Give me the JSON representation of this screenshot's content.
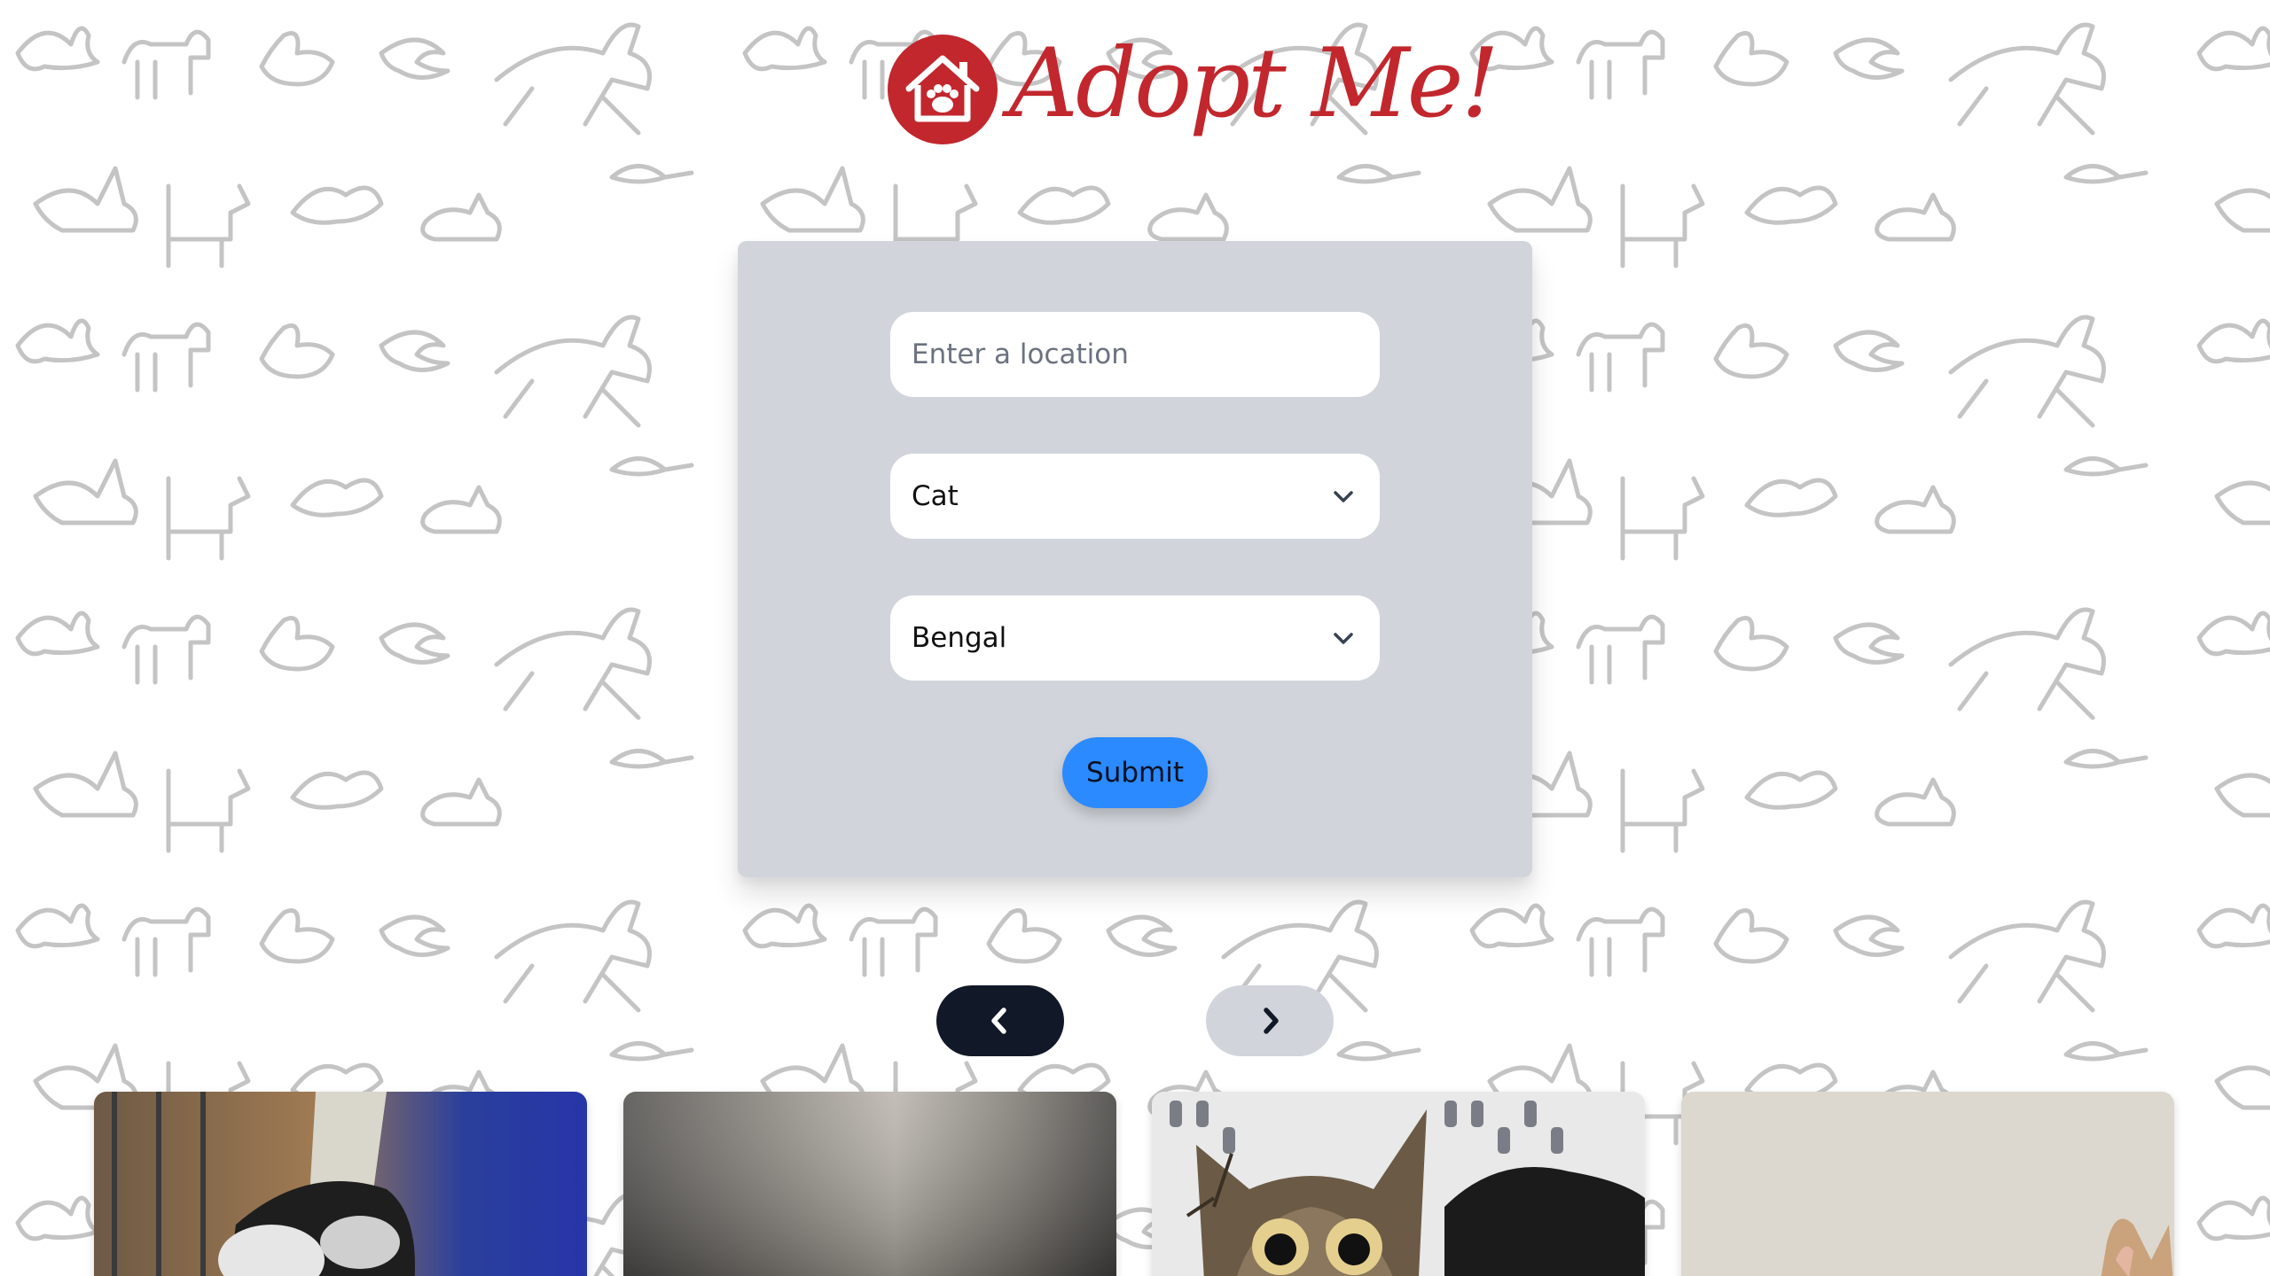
{
  "brand": {
    "name": "Adopt Me!",
    "color": "#c1272d"
  },
  "search": {
    "location_placeholder": "Enter a location",
    "location_value": "",
    "animal_value": "Cat",
    "breed_value": "Bengal",
    "submit_label": "Submit"
  },
  "pagination": {
    "prev_icon": "chevron-left-icon",
    "next_icon": "chevron-right-icon"
  },
  "results": [
    {
      "icon": "pet-photo"
    },
    {
      "icon": "pet-photo"
    },
    {
      "icon": "pet-photo"
    },
    {
      "icon": "pet-photo"
    }
  ],
  "colors": {
    "panel": "#d1d5db",
    "submit": "#2b8aff",
    "nav_active": "#111827",
    "nav_inactive": "#d1d5db"
  }
}
